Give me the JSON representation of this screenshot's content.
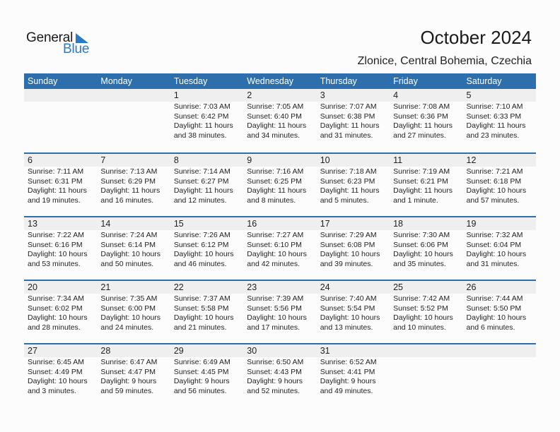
{
  "logo": {
    "word1": "General",
    "word2": "Blue"
  },
  "header": {
    "title": "October 2024",
    "location": "Zlonice, Central Bohemia, Czechia"
  },
  "colors": {
    "accent": "#2d6fad",
    "strip": "#efefef",
    "logo_blue": "#2a7bc4"
  },
  "weekdays": [
    "Sunday",
    "Monday",
    "Tuesday",
    "Wednesday",
    "Thursday",
    "Friday",
    "Saturday"
  ],
  "weeks": [
    [
      {
        "day": "",
        "sunrise": "",
        "sunset": "",
        "daylight": "",
        "minutes": ""
      },
      {
        "day": "",
        "sunrise": "",
        "sunset": "",
        "daylight": "",
        "minutes": ""
      },
      {
        "day": "1",
        "sunrise": "Sunrise: 7:03 AM",
        "sunset": "Sunset: 6:42 PM",
        "daylight": "Daylight: 11 hours",
        "minutes": "and 38 minutes."
      },
      {
        "day": "2",
        "sunrise": "Sunrise: 7:05 AM",
        "sunset": "Sunset: 6:40 PM",
        "daylight": "Daylight: 11 hours",
        "minutes": "and 34 minutes."
      },
      {
        "day": "3",
        "sunrise": "Sunrise: 7:07 AM",
        "sunset": "Sunset: 6:38 PM",
        "daylight": "Daylight: 11 hours",
        "minutes": "and 31 minutes."
      },
      {
        "day": "4",
        "sunrise": "Sunrise: 7:08 AM",
        "sunset": "Sunset: 6:36 PM",
        "daylight": "Daylight: 11 hours",
        "minutes": "and 27 minutes."
      },
      {
        "day": "5",
        "sunrise": "Sunrise: 7:10 AM",
        "sunset": "Sunset: 6:33 PM",
        "daylight": "Daylight: 11 hours",
        "minutes": "and 23 minutes."
      }
    ],
    [
      {
        "day": "6",
        "sunrise": "Sunrise: 7:11 AM",
        "sunset": "Sunset: 6:31 PM",
        "daylight": "Daylight: 11 hours",
        "minutes": "and 19 minutes."
      },
      {
        "day": "7",
        "sunrise": "Sunrise: 7:13 AM",
        "sunset": "Sunset: 6:29 PM",
        "daylight": "Daylight: 11 hours",
        "minutes": "and 16 minutes."
      },
      {
        "day": "8",
        "sunrise": "Sunrise: 7:14 AM",
        "sunset": "Sunset: 6:27 PM",
        "daylight": "Daylight: 11 hours",
        "minutes": "and 12 minutes."
      },
      {
        "day": "9",
        "sunrise": "Sunrise: 7:16 AM",
        "sunset": "Sunset: 6:25 PM",
        "daylight": "Daylight: 11 hours",
        "minutes": "and 8 minutes."
      },
      {
        "day": "10",
        "sunrise": "Sunrise: 7:18 AM",
        "sunset": "Sunset: 6:23 PM",
        "daylight": "Daylight: 11 hours",
        "minutes": "and 5 minutes."
      },
      {
        "day": "11",
        "sunrise": "Sunrise: 7:19 AM",
        "sunset": "Sunset: 6:21 PM",
        "daylight": "Daylight: 11 hours",
        "minutes": "and 1 minute."
      },
      {
        "day": "12",
        "sunrise": "Sunrise: 7:21 AM",
        "sunset": "Sunset: 6:18 PM",
        "daylight": "Daylight: 10 hours",
        "minutes": "and 57 minutes."
      }
    ],
    [
      {
        "day": "13",
        "sunrise": "Sunrise: 7:22 AM",
        "sunset": "Sunset: 6:16 PM",
        "daylight": "Daylight: 10 hours",
        "minutes": "and 53 minutes."
      },
      {
        "day": "14",
        "sunrise": "Sunrise: 7:24 AM",
        "sunset": "Sunset: 6:14 PM",
        "daylight": "Daylight: 10 hours",
        "minutes": "and 50 minutes."
      },
      {
        "day": "15",
        "sunrise": "Sunrise: 7:26 AM",
        "sunset": "Sunset: 6:12 PM",
        "daylight": "Daylight: 10 hours",
        "minutes": "and 46 minutes."
      },
      {
        "day": "16",
        "sunrise": "Sunrise: 7:27 AM",
        "sunset": "Sunset: 6:10 PM",
        "daylight": "Daylight: 10 hours",
        "minutes": "and 42 minutes."
      },
      {
        "day": "17",
        "sunrise": "Sunrise: 7:29 AM",
        "sunset": "Sunset: 6:08 PM",
        "daylight": "Daylight: 10 hours",
        "minutes": "and 39 minutes."
      },
      {
        "day": "18",
        "sunrise": "Sunrise: 7:30 AM",
        "sunset": "Sunset: 6:06 PM",
        "daylight": "Daylight: 10 hours",
        "minutes": "and 35 minutes."
      },
      {
        "day": "19",
        "sunrise": "Sunrise: 7:32 AM",
        "sunset": "Sunset: 6:04 PM",
        "daylight": "Daylight: 10 hours",
        "minutes": "and 31 minutes."
      }
    ],
    [
      {
        "day": "20",
        "sunrise": "Sunrise: 7:34 AM",
        "sunset": "Sunset: 6:02 PM",
        "daylight": "Daylight: 10 hours",
        "minutes": "and 28 minutes."
      },
      {
        "day": "21",
        "sunrise": "Sunrise: 7:35 AM",
        "sunset": "Sunset: 6:00 PM",
        "daylight": "Daylight: 10 hours",
        "minutes": "and 24 minutes."
      },
      {
        "day": "22",
        "sunrise": "Sunrise: 7:37 AM",
        "sunset": "Sunset: 5:58 PM",
        "daylight": "Daylight: 10 hours",
        "minutes": "and 21 minutes."
      },
      {
        "day": "23",
        "sunrise": "Sunrise: 7:39 AM",
        "sunset": "Sunset: 5:56 PM",
        "daylight": "Daylight: 10 hours",
        "minutes": "and 17 minutes."
      },
      {
        "day": "24",
        "sunrise": "Sunrise: 7:40 AM",
        "sunset": "Sunset: 5:54 PM",
        "daylight": "Daylight: 10 hours",
        "minutes": "and 13 minutes."
      },
      {
        "day": "25",
        "sunrise": "Sunrise: 7:42 AM",
        "sunset": "Sunset: 5:52 PM",
        "daylight": "Daylight: 10 hours",
        "minutes": "and 10 minutes."
      },
      {
        "day": "26",
        "sunrise": "Sunrise: 7:44 AM",
        "sunset": "Sunset: 5:50 PM",
        "daylight": "Daylight: 10 hours",
        "minutes": "and 6 minutes."
      }
    ],
    [
      {
        "day": "27",
        "sunrise": "Sunrise: 6:45 AM",
        "sunset": "Sunset: 4:49 PM",
        "daylight": "Daylight: 10 hours",
        "minutes": "and 3 minutes."
      },
      {
        "day": "28",
        "sunrise": "Sunrise: 6:47 AM",
        "sunset": "Sunset: 4:47 PM",
        "daylight": "Daylight: 9 hours",
        "minutes": "and 59 minutes."
      },
      {
        "day": "29",
        "sunrise": "Sunrise: 6:49 AM",
        "sunset": "Sunset: 4:45 PM",
        "daylight": "Daylight: 9 hours",
        "minutes": "and 56 minutes."
      },
      {
        "day": "30",
        "sunrise": "Sunrise: 6:50 AM",
        "sunset": "Sunset: 4:43 PM",
        "daylight": "Daylight: 9 hours",
        "minutes": "and 52 minutes."
      },
      {
        "day": "31",
        "sunrise": "Sunrise: 6:52 AM",
        "sunset": "Sunset: 4:41 PM",
        "daylight": "Daylight: 9 hours",
        "minutes": "and 49 minutes."
      },
      {
        "day": "",
        "sunrise": "",
        "sunset": "",
        "daylight": "",
        "minutes": ""
      },
      {
        "day": "",
        "sunrise": "",
        "sunset": "",
        "daylight": "",
        "minutes": ""
      }
    ]
  ]
}
